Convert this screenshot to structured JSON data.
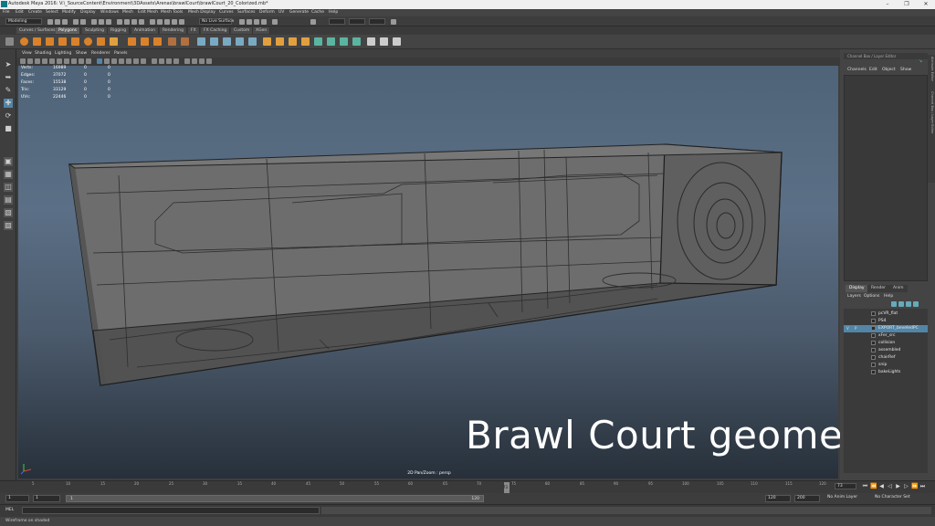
{
  "window": {
    "title": "Autodesk Maya 2016: V:\\_SourceContent\\Environment\\3DAssets\\Arenas\\brawlCourt\\brawlCourt_20_Colorized.mb*"
  },
  "menubar": {
    "items": [
      "File",
      "Edit",
      "Create",
      "Select",
      "Modify",
      "Display",
      "Windows",
      "Mesh",
      "Edit Mesh",
      "Mesh Tools",
      "Mesh Display",
      "Curves",
      "Surfaces",
      "Deform",
      "UV",
      "Generate",
      "Cache",
      "Help"
    ]
  },
  "statusline": {
    "mode": "Modeling",
    "live_surface": "No Live Surface"
  },
  "shelf": {
    "tabs": [
      "Curves / Surfaces",
      "Polygons",
      "Sculpting",
      "Rigging",
      "Animation",
      "Rendering",
      "FX",
      "FX Caching",
      "Custom",
      "XGen"
    ],
    "active_tab": "Polygons"
  },
  "viewport": {
    "menu": [
      "View",
      "Shading",
      "Lighting",
      "Show",
      "Renderer",
      "Panels"
    ],
    "hud": [
      {
        "label": "Verts:",
        "v1": "16989",
        "v2": "0",
        "v3": "0"
      },
      {
        "label": "Edges:",
        "v1": "37072",
        "v2": "0",
        "v3": "0"
      },
      {
        "label": "Faces:",
        "v1": "15538",
        "v2": "0",
        "v3": "0"
      },
      {
        "label": "Tris:",
        "v1": "33129",
        "v2": "0",
        "v3": "0"
      },
      {
        "label": "UVs:",
        "v1": "22446",
        "v2": "0",
        "v3": "0"
      }
    ],
    "camera_label": "2D Pan/Zoom : persp"
  },
  "overlay": {
    "caption": "Brawl Court geometry"
  },
  "channel_box": {
    "title": "Channel Box / Layer Editor",
    "menu": [
      "Channels",
      "Edit",
      "Object",
      "Show"
    ],
    "side_tabs": [
      "Channel Box / Layer Editor",
      "Attribute Editor"
    ]
  },
  "layer_editor": {
    "tabs": [
      "Display",
      "Render",
      "Anim"
    ],
    "active_tab": "Display",
    "menu": [
      "Layers",
      "Options",
      "Help"
    ],
    "layers": [
      {
        "name": "pcVR_flat",
        "v": "",
        "p": "",
        "selected": false
      },
      {
        "name": "PS4",
        "v": "",
        "p": "",
        "selected": false
      },
      {
        "name": "EXPORT_beveledPC",
        "v": "V",
        "p": "P",
        "selected": true
      },
      {
        "name": "xFer_src",
        "v": "",
        "p": "",
        "selected": false
      },
      {
        "name": "collision",
        "v": "",
        "p": "",
        "selected": false
      },
      {
        "name": "assembled",
        "v": "",
        "p": "",
        "selected": false
      },
      {
        "name": "chairRef",
        "v": "",
        "p": "",
        "selected": false
      },
      {
        "name": "snip",
        "v": "",
        "p": "",
        "selected": false
      },
      {
        "name": "bakeLights",
        "v": "",
        "p": "",
        "selected": false
      }
    ]
  },
  "timeline": {
    "tick_labels": [
      "5",
      "10",
      "15",
      "20",
      "25",
      "30",
      "35",
      "40",
      "45",
      "50",
      "55",
      "60",
      "65",
      "70",
      "75",
      "80",
      "85",
      "90",
      "95",
      "100",
      "105",
      "110",
      "115",
      "120"
    ],
    "current_frame": "73",
    "frame_field": "73"
  },
  "range": {
    "start": "1",
    "inner_start": "1",
    "bar_start": "1",
    "bar_end": "120",
    "end": "120",
    "total_end": "200",
    "anim_layer": "No Anim Layer",
    "character_set": "No Character Set"
  },
  "command_line": {
    "label": "MEL"
  },
  "help_line": {
    "text": "Wireframe on shaded"
  }
}
